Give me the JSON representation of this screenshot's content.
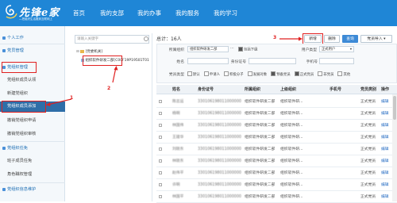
{
  "header": {
    "logo_text": "先锋e家",
    "logo_slogan": "—把组织生活搬到互联网上",
    "nav": [
      "首页",
      "我的支部",
      "我的办事",
      "我的服务",
      "我的学习"
    ]
  },
  "sidebar": {
    "items": [
      {
        "label": "个人工作",
        "head": true
      },
      {
        "label": "党员管理",
        "head": true
      },
      {
        "label": "党组织管理",
        "head": true
      },
      {
        "label": "党组织成员认领",
        "head": false
      },
      {
        "label": "新建党组织",
        "head": false
      },
      {
        "label": "党组织成员添加",
        "head": false,
        "active": true
      },
      {
        "label": "撤销党组织申请",
        "head": false
      },
      {
        "label": "撤销党组织审核",
        "head": false
      },
      {
        "label": "党组织任免",
        "head": true
      },
      {
        "label": "班子成员任免",
        "head": false
      },
      {
        "label": "角色職权管理",
        "head": false
      },
      {
        "label": "党组织信息维护",
        "head": true
      }
    ]
  },
  "tree": {
    "search_placeholder": "请输入关键字",
    "root_label": "[党委机关]",
    "node_label": "组织软件研发二部[C00F19P19501T01"
  },
  "annotations": {
    "n1": "1",
    "n2": "2",
    "n3": "3"
  },
  "toolbar": {
    "total": "总计：16人",
    "add": "新增",
    "delete": "删除",
    "query": "查询",
    "import": "党员导入"
  },
  "filters": {
    "org_label": "所属组织",
    "org_value": "组织软件研发二部",
    "include_sub": "包括下级",
    "user_type_label": "用户类型",
    "user_type_value": "正式用户",
    "name_label": "姓名",
    "idcard_label": "身份证号",
    "phone_label": "手机号",
    "party_type_label": "党员类型",
    "types": [
      {
        "label": "默认",
        "on": false
      },
      {
        "label": "申请人",
        "on": false
      },
      {
        "label": "积极分子",
        "on": false
      },
      {
        "label": "发展对象",
        "on": false
      },
      {
        "label": "预备党员",
        "on": true
      },
      {
        "label": "正式党员",
        "on": true
      },
      {
        "label": "非党员",
        "on": false
      },
      {
        "label": "其他",
        "on": false
      }
    ]
  },
  "table": {
    "headers": [
      "姓名",
      "身份证号",
      "所属组织",
      "上级组织",
      "手机号",
      "党员类别",
      "操作"
    ],
    "rows": [
      {
        "name": "陈志远",
        "id": "330106198011000000",
        "org": "组织软件研发二部",
        "parent": "组织软件研...",
        "phone": "",
        "type": "正式党员",
        "op": "编辑"
      },
      {
        "name": "杨明",
        "id": "330106198011000000",
        "org": "组织软件研发二部",
        "parent": "组织软件研...",
        "phone": "",
        "type": "正式党员",
        "op": "编辑"
      },
      {
        "name": "林国伟",
        "id": "330106198011000000",
        "org": "组织软件研发二部",
        "parent": "组织软件研...",
        "phone": "",
        "type": "正式党员",
        "op": "编辑"
      },
      {
        "name": "王建华",
        "id": "330106198011000000",
        "org": "组织软件研发二部",
        "parent": "组织软件研...",
        "phone": "",
        "type": "正式党员",
        "op": "编辑"
      },
      {
        "name": "刘晓东",
        "id": "330106198011000000",
        "org": "组织软件研发二部",
        "parent": "组织软件研...",
        "phone": "",
        "type": "正式党员",
        "op": "编辑"
      },
      {
        "name": "林晓东",
        "id": "330106198011000000",
        "org": "组织软件研发二部",
        "parent": "组织软件研...",
        "phone": "",
        "type": "正式党员",
        "op": "编辑"
      },
      {
        "name": "赵伟平",
        "id": "330106198011000000",
        "org": "组织软件研发二部",
        "parent": "组织软件研...",
        "phone": "",
        "type": "正式党员",
        "op": "编辑"
      },
      {
        "name": "许明",
        "id": "330106198011000000",
        "org": "组织软件研发二部",
        "parent": "组织软件研...",
        "phone": "",
        "type": "正式党员",
        "op": "编辑"
      },
      {
        "name": "林国平",
        "id": "330106198011000000",
        "org": "组织软件研发二部",
        "parent": "组织软件研...",
        "phone": "",
        "type": "正式党员",
        "op": "编辑"
      }
    ]
  }
}
